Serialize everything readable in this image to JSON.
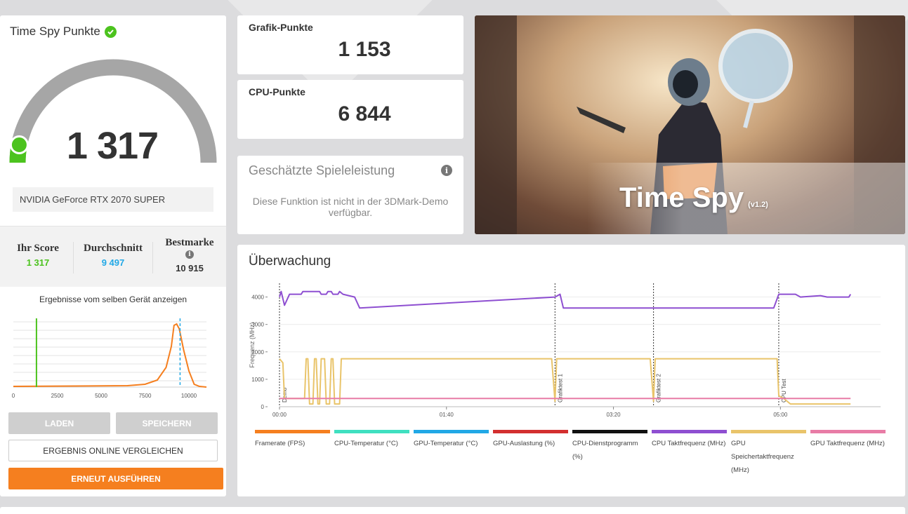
{
  "left": {
    "title": "Time Spy Punkte",
    "score": "1 317",
    "gauge_fraction": 0.06,
    "gpu": "NVIDIA GeForce RTX 2070 SUPER",
    "stats": {
      "your_label": "Ihr Score",
      "your_value": "1 317",
      "avg_label": "Durchschnitt",
      "avg_value": "9 497",
      "best_label": "Bestmarke",
      "best_value": "10 915"
    },
    "same_device": "Ergebnisse vom selben Gerät anzeigen",
    "buttons": {
      "load": "LADEN",
      "save": "SPEICHERN",
      "compare": "ERGEBNIS ONLINE VERGLEICHEN",
      "rerun": "ERNEUT AUSFÜHREN"
    }
  },
  "histogram": {
    "x_ticks": [
      "0",
      "2500",
      "5000",
      "7500",
      "10000"
    ],
    "your_score": 1317,
    "avg_score": 9497,
    "xmax": 11000
  },
  "graphics": {
    "label": "Grafik-Punkte",
    "value": "1 153"
  },
  "cpu": {
    "label": "CPU-Punkte",
    "value": "6 844"
  },
  "estimate": {
    "title": "Geschätzte Spieleleistung",
    "message": "Diese Funktion ist nicht in der 3DMark-Demo verfügbar."
  },
  "hero": {
    "title": "Time Spy",
    "version": "(v1.2)"
  },
  "monitor": {
    "title": "Überwachung"
  },
  "chart_data": {
    "type": "line",
    "ylabel": "Frequenz (MHz)",
    "y_ticks": [
      "0",
      "1000",
      "2000",
      "3000",
      "4000"
    ],
    "x_ticks": [
      "00:00",
      "01:40",
      "03:20",
      "05:00"
    ],
    "ylim": [
      0,
      4500
    ],
    "xlim": [
      0,
      360
    ],
    "markers": [
      {
        "t": 0,
        "label": "Demo"
      },
      {
        "t": 165,
        "label": "Grafiktest 1"
      },
      {
        "t": 224,
        "label": "Grafiktest 2"
      },
      {
        "t": 299,
        "label": "CPU Test"
      }
    ],
    "legend": [
      {
        "name": "Framerate (FPS)",
        "color": "#f57f1f"
      },
      {
        "name": "CPU-Temperatur (°C)",
        "color": "#3fe0c0"
      },
      {
        "name": "GPU-Temperatur (°C)",
        "color": "#21a8e6"
      },
      {
        "name": "GPU-Auslastung (%)",
        "color": "#d32f2f"
      },
      {
        "name": "CPU-Dienstprogramm (%)",
        "color": "#111111"
      },
      {
        "name": "CPU Taktfrequenz (MHz)",
        "color": "#8e4fd1"
      },
      {
        "name": "GPU Speichertaktfrequenz (MHz)",
        "color": "#e9c46a"
      },
      {
        "name": "GPU Taktfrequenz (MHz)",
        "color": "#e87ca6"
      }
    ],
    "series": [
      {
        "name": "CPU Taktfrequenz (MHz)",
        "points": [
          [
            0,
            4000
          ],
          [
            1,
            4200
          ],
          [
            3,
            3700
          ],
          [
            6,
            4100
          ],
          [
            13,
            4100
          ],
          [
            14,
            4200
          ],
          [
            24,
            4200
          ],
          [
            25,
            4100
          ],
          [
            28,
            4100
          ],
          [
            29,
            4200
          ],
          [
            31,
            4200
          ],
          [
            32,
            4100
          ],
          [
            35,
            4100
          ],
          [
            36,
            4200
          ],
          [
            38,
            4100
          ],
          [
            45,
            4000
          ],
          [
            48,
            3600
          ],
          [
            165,
            4000
          ],
          [
            168,
            4100
          ],
          [
            170,
            3600
          ],
          [
            296,
            3600
          ],
          [
            299,
            4100
          ],
          [
            309,
            4100
          ],
          [
            312,
            4000
          ],
          [
            324,
            4050
          ],
          [
            328,
            4000
          ],
          [
            341,
            4000
          ],
          [
            342,
            4100
          ]
        ]
      },
      {
        "name": "GPU Speichertaktfrequenz (MHz)",
        "points": [
          [
            0,
            1750
          ],
          [
            2,
            1600
          ],
          [
            3,
            300
          ],
          [
            15,
            300
          ],
          [
            16,
            1750
          ],
          [
            17,
            1750
          ],
          [
            18,
            100
          ],
          [
            20,
            100
          ],
          [
            21,
            1750
          ],
          [
            22,
            1750
          ],
          [
            23,
            100
          ],
          [
            24,
            100
          ],
          [
            25,
            1750
          ],
          [
            27,
            1750
          ],
          [
            28,
            100
          ],
          [
            30,
            100
          ],
          [
            31,
            1750
          ],
          [
            32,
            1750
          ],
          [
            33,
            100
          ],
          [
            36,
            100
          ],
          [
            37,
            1750
          ],
          [
            163,
            1750
          ],
          [
            165,
            200
          ],
          [
            166,
            1750
          ],
          [
            222,
            1750
          ],
          [
            224,
            200
          ],
          [
            225,
            1750
          ],
          [
            298,
            1750
          ],
          [
            299,
            400
          ],
          [
            302,
            300
          ],
          [
            306,
            100
          ],
          [
            342,
            100
          ]
        ]
      },
      {
        "name": "GPU Taktfrequenz (MHz)",
        "points": [
          [
            0,
            300
          ],
          [
            342,
            300
          ]
        ]
      }
    ]
  }
}
